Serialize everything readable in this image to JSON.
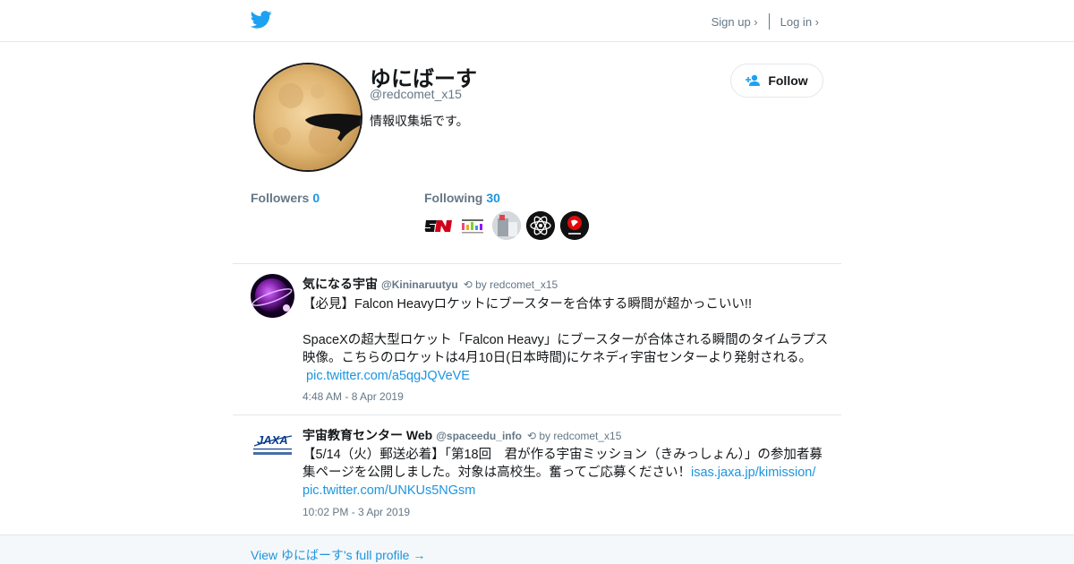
{
  "header": {
    "logo_icon": "twitter-bird-icon",
    "signup_label": "Sign up ›",
    "login_label": "Log in ›",
    "brand_color": "#1da1f2"
  },
  "profile": {
    "display_name": "ゆにばーす",
    "handle": "@redcomet_x15",
    "bio": "情報収集垢です。",
    "follow_label": "Follow",
    "followers_label": "Followers",
    "followers_count": "0",
    "following_label": "Following",
    "following_count": "30"
  },
  "tweets": [
    {
      "author_name": "気になる宇宙",
      "author_handle": "@Kininaruutyu",
      "retweet_by": "by redcomet_x15",
      "text1": "【必見】Falcon Heavyロケットにブースターを合体する瞬間が超かっこいい!!",
      "text2": "SpaceXの超大型ロケット「Falcon Heavy」にブースターが合体される瞬間のタイムラプス映像。こちらのロケットは4月10日(日本時間)にケネディ宇宙センターより発射される。",
      "link1": "pic.twitter.com/a5qgJQVeVE",
      "timestamp": "4:48 AM - 8 Apr 2019"
    },
    {
      "author_name": "宇宙教育センター Web",
      "author_handle": "@spaceedu_info",
      "retweet_by": "by redcomet_x15",
      "text1": "【5/14（火）郵送必着】「第18回　君が作る宇宙ミッション（きみっしょん）」の参加者募集ページを公開しました。対象は高校生。奮ってご応募ください！",
      "link1": "isas.jaxa.jp/kimission/",
      "link2": "pic.twitter.com/UNKUs5NGsm",
      "timestamp": "10:02 PM - 3 Apr 2019"
    }
  ],
  "footer": {
    "full_profile_link": "View ゆにばーす's full profile →"
  }
}
